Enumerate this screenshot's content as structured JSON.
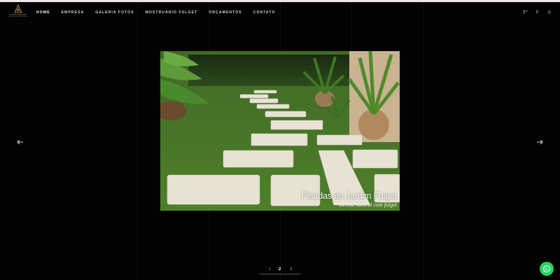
{
  "logo": {
    "name": "PISOS FULGET",
    "tagline": "Pavimentação & Revestimentos"
  },
  "nav": {
    "items": [
      {
        "label": "HOME",
        "active": true
      },
      {
        "label": "EMPRESA",
        "active": false
      },
      {
        "label": "GALERIA FOTOS",
        "active": false
      },
      {
        "label": "MOSTRUÁRIO FULGET",
        "active": false
      },
      {
        "label": "ORÇAMENTOS",
        "active": false
      },
      {
        "label": "CONTATO",
        "active": false
      }
    ]
  },
  "social": {
    "google_plus": "g+",
    "pinterest": "p",
    "instagram": "◎"
  },
  "slider": {
    "prev_icon": "arrow-left-icon",
    "next_icon": "arrow-right-icon",
    "caption_title": "Pisadas de Jardim Fulget",
    "caption_subtitle": "Beleza natural com fulget"
  },
  "pager": {
    "pages": [
      "1",
      "2",
      "3"
    ],
    "current": "2"
  },
  "colors": {
    "background": "#020202",
    "accent_gold": "#c9a86a",
    "whatsapp": "#25d366",
    "topbar": "#efe6e6"
  }
}
